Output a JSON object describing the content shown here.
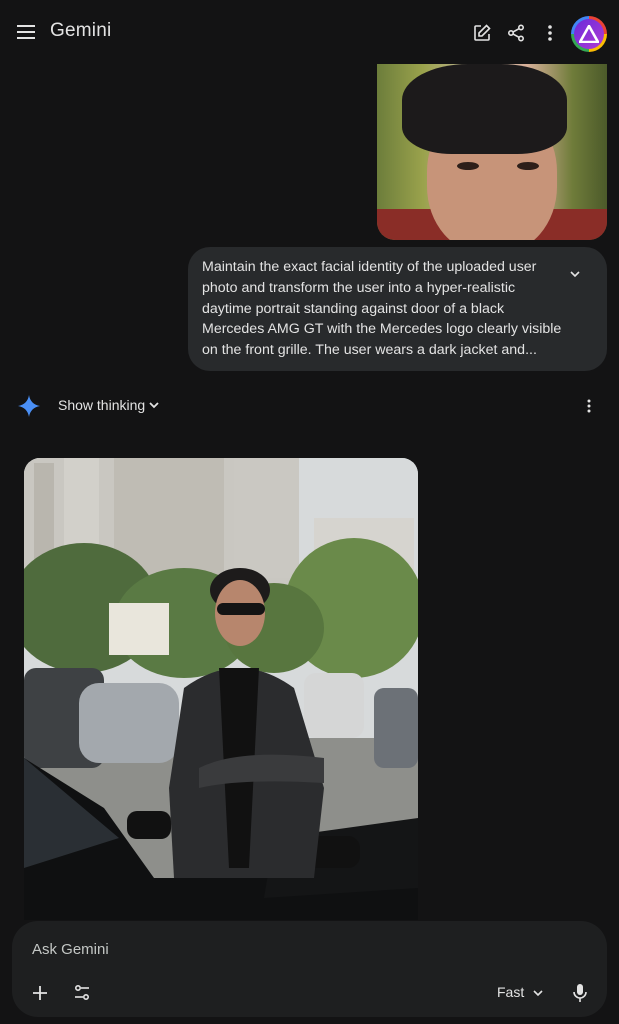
{
  "app": {
    "title": "Gemini"
  },
  "header": {
    "icons": [
      "menu-icon",
      "edit-icon",
      "share-icon",
      "more-vert-icon",
      "avatar"
    ]
  },
  "conversation": {
    "user_prompt": "Maintain the exact facial identity of the uploaded user photo and transform the user into a hyper-realistic daytime portrait standing against door of a black Mercedes AMG GT with the Mercedes logo clearly visible on the front grille. The user wears a dark jacket and...",
    "show_thinking_label": "Show thinking"
  },
  "input": {
    "placeholder": "Ask Gemini",
    "mode_label": "Fast"
  },
  "colors": {
    "background": "#131314",
    "bubble": "#282a2c",
    "input": "#1e1f20",
    "accent": "#4285f4"
  }
}
